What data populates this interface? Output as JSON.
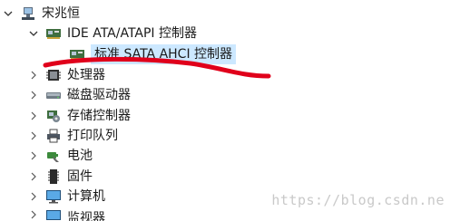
{
  "tree": {
    "computer_name": "宋兆恒",
    "ide_controller": "IDE ATA/ATAPI 控制器",
    "sata_controller": "标准 SATA AHCI 控制器",
    "processor": "处理器",
    "disk_drive": "磁盘驱动器",
    "storage_controller": "存储控制器",
    "print_queue": "打印队列",
    "battery": "电池",
    "firmware": "固件",
    "computer": "计算机",
    "monitor": "监视器"
  },
  "watermark": "https://blog.csdn.ne",
  "colors": {
    "selection": "#cce8ff",
    "annotation": "#e0001b"
  },
  "icons": [
    "computer-icon",
    "controller-card-icon",
    "cpu-chip-icon",
    "disk-drive-icon",
    "storage-controller-icon",
    "printer-icon",
    "battery-icon",
    "firmware-chip-icon",
    "monitor-icon"
  ]
}
